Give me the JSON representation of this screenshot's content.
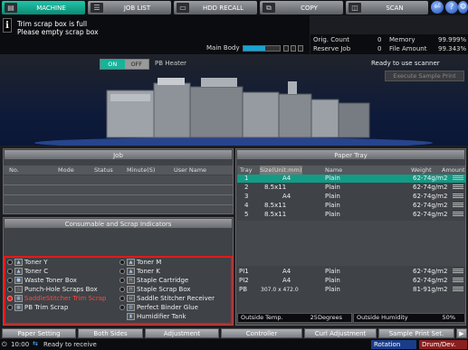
{
  "tabs": [
    {
      "label": "MACHINE",
      "icon": "printer-icon"
    },
    {
      "label": "JOB LIST",
      "icon": "list-icon"
    },
    {
      "label": "HDD RECALL",
      "icon": "hdd-icon"
    },
    {
      "label": "COPY",
      "icon": "copy-icon"
    },
    {
      "label": "SCAN",
      "icon": "scan-icon"
    }
  ],
  "header_buttons": {
    "back": "⏎",
    "help": "?",
    "settings": "⚙"
  },
  "message": {
    "line1": "Trim scrap box is full",
    "line2": "Please empty scrap box",
    "icon": "info-icon"
  },
  "main_body": {
    "label": "Main Body",
    "level": 0.6
  },
  "counters": {
    "orig_count_label": "Orig. Count",
    "orig_count": "0",
    "memory_label": "Memory",
    "memory": "99.999%",
    "reserve_job_label": "Reserve Job",
    "reserve_job": "0",
    "file_amount_label": "File Amount",
    "file_amount": "99.343%"
  },
  "heater": {
    "on": "ON",
    "off": "OFF",
    "label": "PB Heater"
  },
  "status": {
    "ready": "Ready to use scanner",
    "sample_print": "Execute Sample Print"
  },
  "job": {
    "title": "Job",
    "columns": [
      "No.",
      "Mode",
      "Status",
      "Minute(S)",
      "User Name"
    ]
  },
  "paper_tray": {
    "title": "Paper Tray",
    "columns": [
      "Tray",
      "Size(Unit:mm)",
      "Name",
      "Weight",
      "Amount"
    ],
    "rows": [
      {
        "tray": "1",
        "size": "A4",
        "name": "Plain",
        "weight": "62-74g/m2"
      },
      {
        "tray": "2",
        "size": "8.5x11",
        "name": "Plain",
        "weight": "62-74g/m2"
      },
      {
        "tray": "3",
        "size": "A4",
        "name": "Plain",
        "weight": "62-74g/m2"
      },
      {
        "tray": "4",
        "size": "8.5x11",
        "name": "Plain",
        "weight": "62-74g/m2"
      },
      {
        "tray": "5",
        "size": "8.5x11",
        "name": "Plain",
        "weight": "62-74g/m2"
      }
    ],
    "extra_rows": [
      {
        "tray": "PI1",
        "size": "A4",
        "name": "Plain",
        "weight": "62-74g/m2"
      },
      {
        "tray": "PI2",
        "size": "A4",
        "name": "Plain",
        "weight": "62-74g/m2"
      },
      {
        "tray": "PB",
        "size": "307.0 x 472.0",
        "name": "Plain",
        "weight": "81-91g/m2"
      }
    ],
    "outside_temp_label": "Outside Temp.",
    "outside_temp": "25Degrees",
    "outside_humidity_label": "Outside Humidity",
    "outside_humidity": "50%"
  },
  "consumables": {
    "title": "Consumable and Scrap Indicators",
    "left": [
      "Toner Y",
      "Toner C",
      "Waste Toner Box",
      "Punch-Hole Scraps Box",
      "SaddleStitcher Trim Scrap",
      "PB Trim Scrap"
    ],
    "right": [
      "Toner M",
      "Toner K",
      "Staple Cartridge",
      "Staple Scrap Box",
      "Saddle Stitcher Receiver",
      "Perfect Binder Glue",
      "Humidifier Tank"
    ],
    "warning_item": "SaddleStitcher Trim Scrap",
    "highlight_color": "#e01a1a"
  },
  "bottom_buttons": [
    "Paper Setting",
    "Both Sides",
    "Adjustment",
    "Controller",
    "Curl Adjustment",
    "Sample Print Set."
  ],
  "statusbar": {
    "time": "10:00",
    "receive": "Ready to receive",
    "rotation": "Rotation",
    "drum": "Drum/Dev."
  },
  "colors": {
    "active_tab": "#19b39a",
    "selected_row": "#139b86",
    "warning": "#e01a1a"
  }
}
